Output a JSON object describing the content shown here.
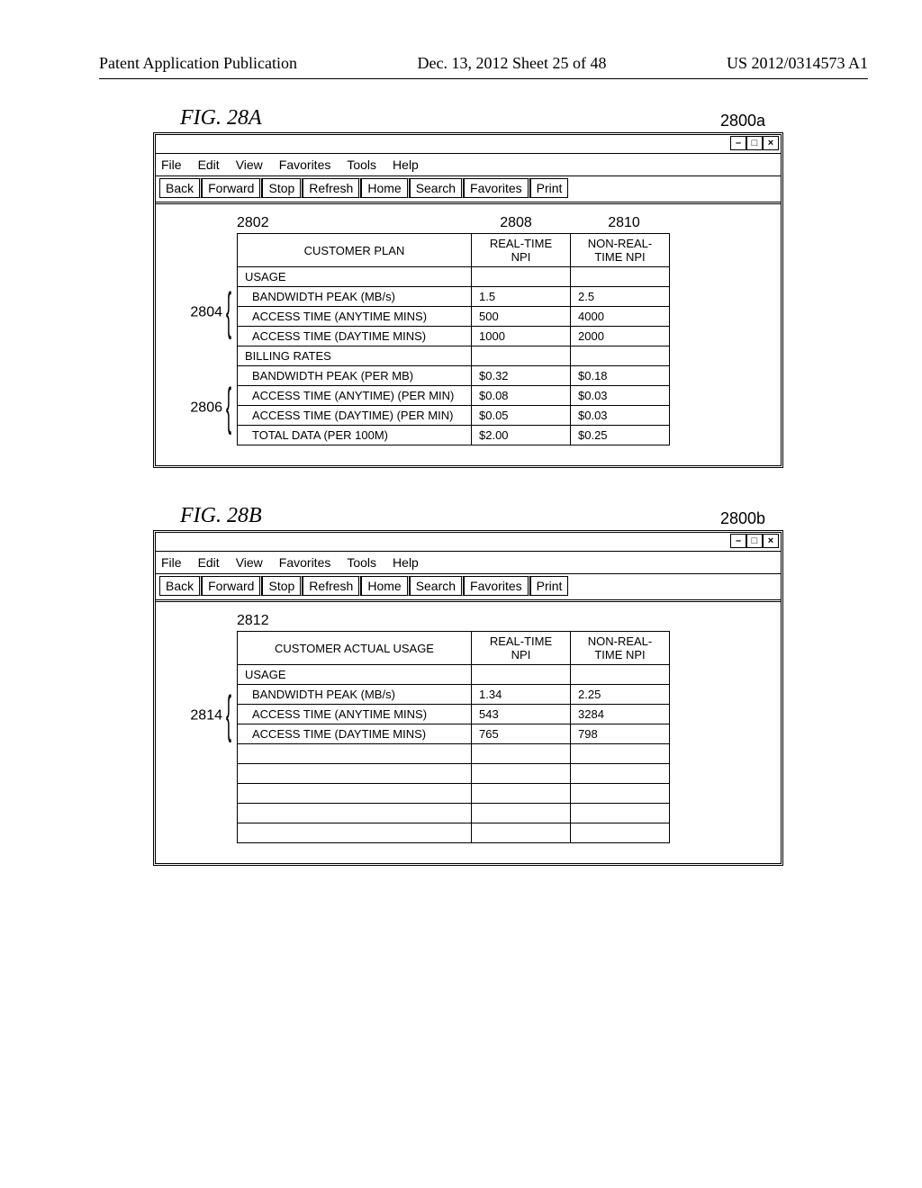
{
  "header": {
    "left": "Patent Application Publication",
    "center": "Dec. 13, 2012  Sheet 25 of 48",
    "right": "US 2012/0314573 A1"
  },
  "menus": [
    "File",
    "Edit",
    "View",
    "Favorites",
    "Tools",
    "Help"
  ],
  "toolbar": [
    "Back",
    "Forward",
    "Stop",
    "Refresh",
    "Home",
    "Search",
    "Favorites",
    "Print"
  ],
  "win_controls": {
    "min": "–",
    "max": "□",
    "close": "×"
  },
  "figA": {
    "label": "FIG. 28A",
    "refnum": "2800a",
    "callout_col_title": "2802",
    "callout_col_rt": "2808",
    "callout_col_nrt": "2810",
    "callout_rows_usage": "2804",
    "callout_rows_billing": "2806",
    "columns": {
      "plan": "CUSTOMER PLAN",
      "rt": "REAL-TIME NPI",
      "nrt": "NON-REAL-TIME NPI"
    },
    "section_usage": "USAGE",
    "rows_usage": [
      {
        "label": "BANDWIDTH PEAK (MB/s)",
        "rt": "1.5",
        "nrt": "2.5"
      },
      {
        "label": "ACCESS TIME (ANYTIME MINS)",
        "rt": "500",
        "nrt": "4000"
      },
      {
        "label": "ACCESS TIME (DAYTIME MINS)",
        "rt": "1000",
        "nrt": "2000"
      }
    ],
    "section_billing": "BILLING RATES",
    "rows_billing": [
      {
        "label": "BANDWIDTH PEAK (PER MB)",
        "rt": "$0.32",
        "nrt": "$0.18"
      },
      {
        "label": "ACCESS TIME (ANYTIME) (PER MIN)",
        "rt": "$0.08",
        "nrt": "$0.03"
      },
      {
        "label": "ACCESS TIME (DAYTIME) (PER MIN)",
        "rt": "$0.05",
        "nrt": "$0.03"
      },
      {
        "label": "TOTAL DATA (PER 100M)",
        "rt": "$2.00",
        "nrt": "$0.25"
      }
    ]
  },
  "figB": {
    "label": "FIG. 28B",
    "refnum": "2800b",
    "callout_col_title": "2812",
    "callout_rows_usage": "2814",
    "columns": {
      "plan": "CUSTOMER ACTUAL USAGE",
      "rt": "REAL-TIME NPI",
      "nrt": "NON-REAL-TIME NPI"
    },
    "section_usage": "USAGE",
    "rows_usage": [
      {
        "label": "BANDWIDTH PEAK (MB/s)",
        "rt": "1.34",
        "nrt": "2.25"
      },
      {
        "label": "ACCESS TIME (ANYTIME MINS)",
        "rt": "543",
        "nrt": "3284"
      },
      {
        "label": "ACCESS TIME (DAYTIME MINS)",
        "rt": "765",
        "nrt": "798"
      }
    ],
    "blank_rows": 5
  }
}
